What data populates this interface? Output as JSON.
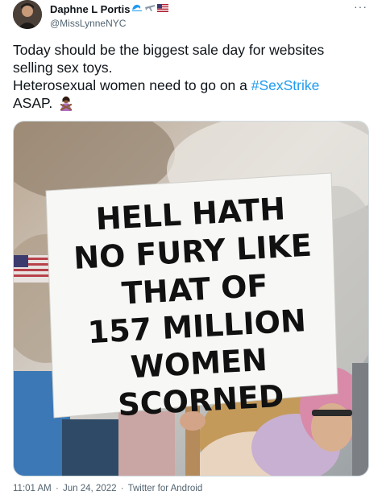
{
  "author": {
    "display_name": "Daphne L Portis",
    "handle": "@MissLynneNYC",
    "badge_icons": [
      "wave-icon",
      "airplane-icon",
      "us-flag-icon"
    ]
  },
  "tweet": {
    "line1": "Today should be the biggest sale day for websites selling sex toys.",
    "line2_prefix": "Heterosexual women need to go on a ",
    "hashtag": "#SexStrike",
    "line2_suffix": "ASAP.",
    "trailing_emoji": "woman-gesturing-no-icon"
  },
  "media": {
    "sign_lines": [
      "HELL  HATH",
      "NO FURY LIKE",
      "THAT OF",
      "157 MILLION",
      "WOMEN",
      "SCORNED"
    ]
  },
  "footer": {
    "time": "11:01 AM",
    "separator": "·",
    "date": "Jun 24, 2022",
    "source": "Twitter for Android"
  },
  "colors": {
    "link": "#1d9bf0",
    "secondary_text": "#536471",
    "primary_text": "#0f1419"
  }
}
